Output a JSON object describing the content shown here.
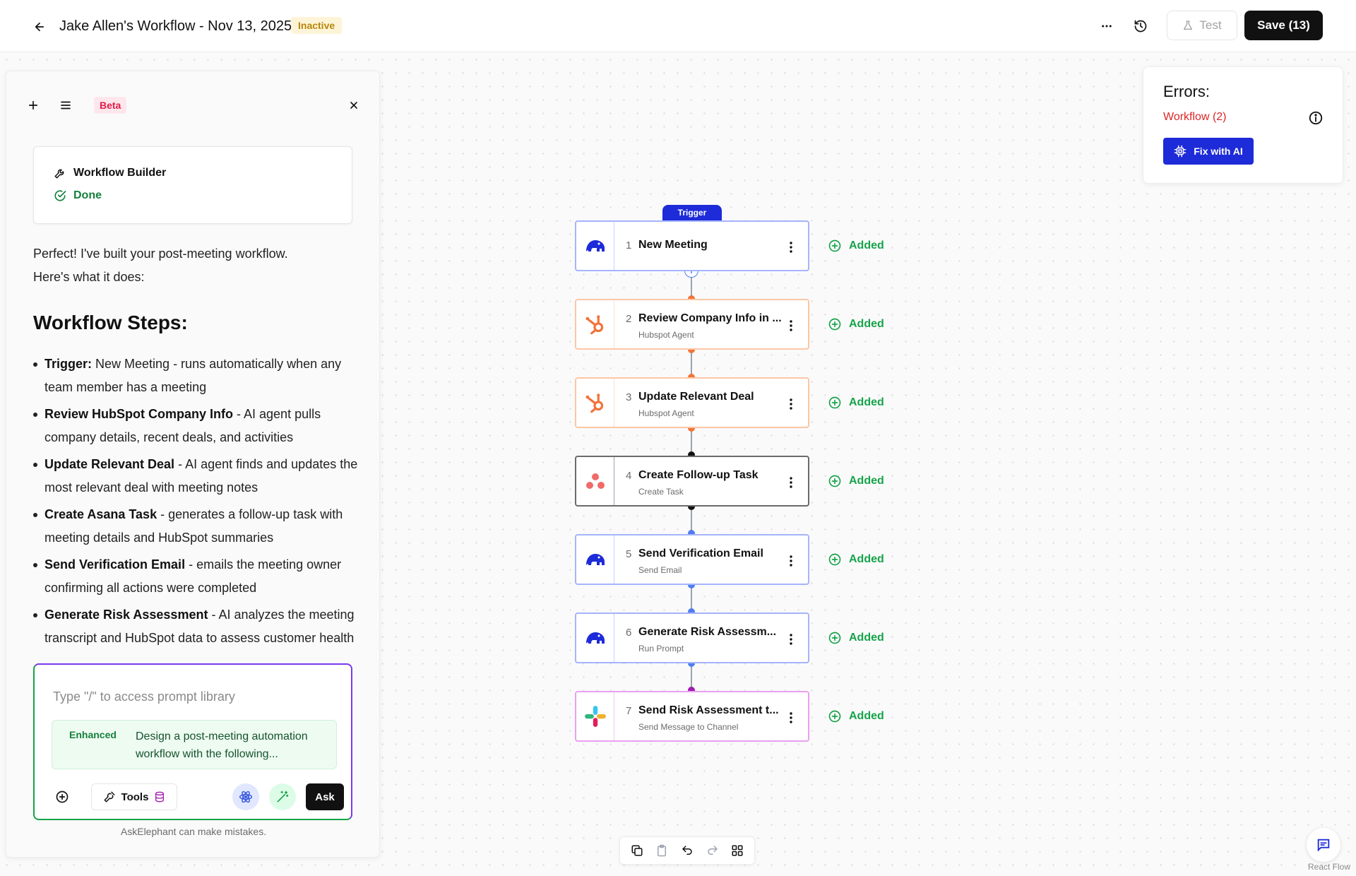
{
  "header": {
    "title": "Jake Allen's Workflow - Nov 13, 2025",
    "status": "Inactive",
    "test_label": "Test",
    "save_label": "Save (13)"
  },
  "chat": {
    "beta_label": "Beta",
    "builder_title": "Workflow Builder",
    "builder_status": "Done",
    "intro_line1": "Perfect! I've built your post-meeting workflow.",
    "intro_line2": "Here's what it does:",
    "steps_heading": "Workflow Steps:",
    "steps": [
      {
        "bold": "Trigger:",
        "text": " New Meeting - runs automatically when any team member has a meeting"
      },
      {
        "bold": "Review HubSpot Company Info",
        "text": " - AI agent pulls company details, recent deals, and activities"
      },
      {
        "bold": "Update Relevant Deal",
        "text": " - AI agent finds and updates the most relevant deal with meeting notes"
      },
      {
        "bold": "Create Asana Task",
        "text": " - generates a follow-up task with meeting details and HubSpot summaries"
      },
      {
        "bold": "Send Verification Email",
        "text": " - emails the meeting owner confirming all actions were completed"
      },
      {
        "bold": "Generate Risk Assessment",
        "text": " - AI analyzes the meeting transcript and HubSpot data to assess customer health"
      }
    ],
    "input_placeholder": "Type \"/\" to access prompt library",
    "enhanced_label": "Enhanced",
    "enhanced_text": "Design a post-meeting automation workflow with the following...",
    "tools_label": "Tools",
    "ask_label": "Ask",
    "disclaimer": "AskElephant can make mistakes."
  },
  "flow": {
    "trigger_label": "Trigger",
    "added_label": "Added",
    "nodes": [
      {
        "num": "1",
        "title": "New Meeting",
        "subtitle": "",
        "icon": "elephant-icon"
      },
      {
        "num": "2",
        "title": "Review Company Info in ...",
        "subtitle": "Hubspot Agent",
        "icon": "hubspot-icon"
      },
      {
        "num": "3",
        "title": "Update Relevant Deal",
        "subtitle": "Hubspot Agent",
        "icon": "hubspot-icon"
      },
      {
        "num": "4",
        "title": "Create Follow-up Task",
        "subtitle": "Create Task",
        "icon": "asana-icon"
      },
      {
        "num": "5",
        "title": "Send Verification Email",
        "subtitle": "Send Email",
        "icon": "elephant-icon"
      },
      {
        "num": "6",
        "title": "Generate Risk Assessm...",
        "subtitle": "Run Prompt",
        "icon": "elephant-icon"
      },
      {
        "num": "7",
        "title": "Send Risk Assessment t...",
        "subtitle": "Send Message to Channel",
        "icon": "slack-icon"
      }
    ]
  },
  "errors": {
    "title": "Errors:",
    "link": "Workflow (2)",
    "fix_label": "Fix with AI"
  },
  "footer": {
    "attribution": "React Flow"
  },
  "colors": {
    "brand_blue": "#1d2bd8",
    "hubspot_orange": "#f2733a",
    "asana_red": "#f06a6a",
    "slack_purple": "#c026d3",
    "success_green": "#16a34a",
    "error_red": "#dc2626"
  }
}
